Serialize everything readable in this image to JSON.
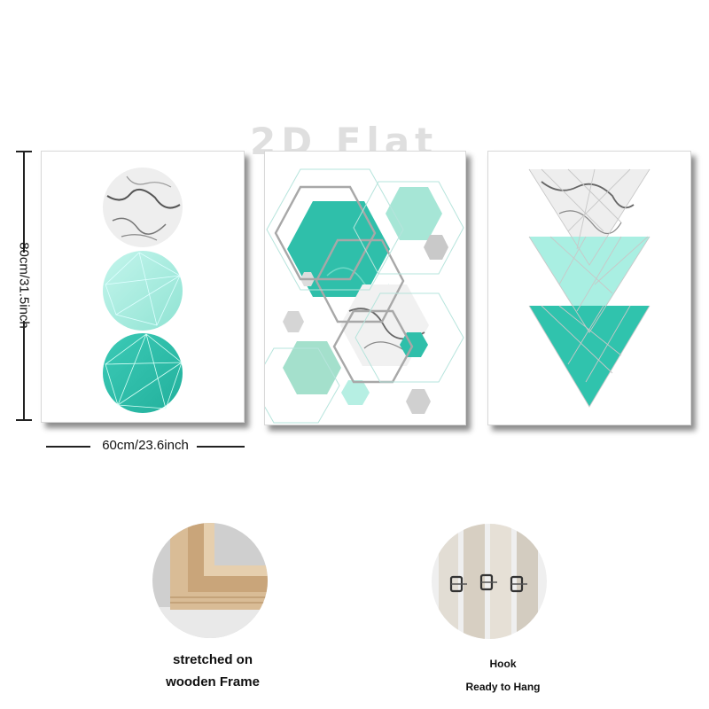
{
  "watermark": "2D Flat",
  "dimensions": {
    "height_label": "80cm/31.5inch",
    "width_label_value": "60",
    "width_label_rest": "cm/23.6inch"
  },
  "panels": [
    {
      "motif": "stacked-circles"
    },
    {
      "motif": "hexagons"
    },
    {
      "motif": "stacked-triangles"
    }
  ],
  "features": [
    {
      "icon": "wooden-frame-corner",
      "lines": [
        "stretched on",
        "wooden Frame"
      ]
    },
    {
      "icon": "hook-clips",
      "lines": [
        "Hook",
        "Ready to Hang"
      ]
    }
  ],
  "colors": {
    "teal": "#34c2ae",
    "mint": "#a8eee0",
    "marble": "#e6e6e6",
    "wood": "#d8b994"
  }
}
